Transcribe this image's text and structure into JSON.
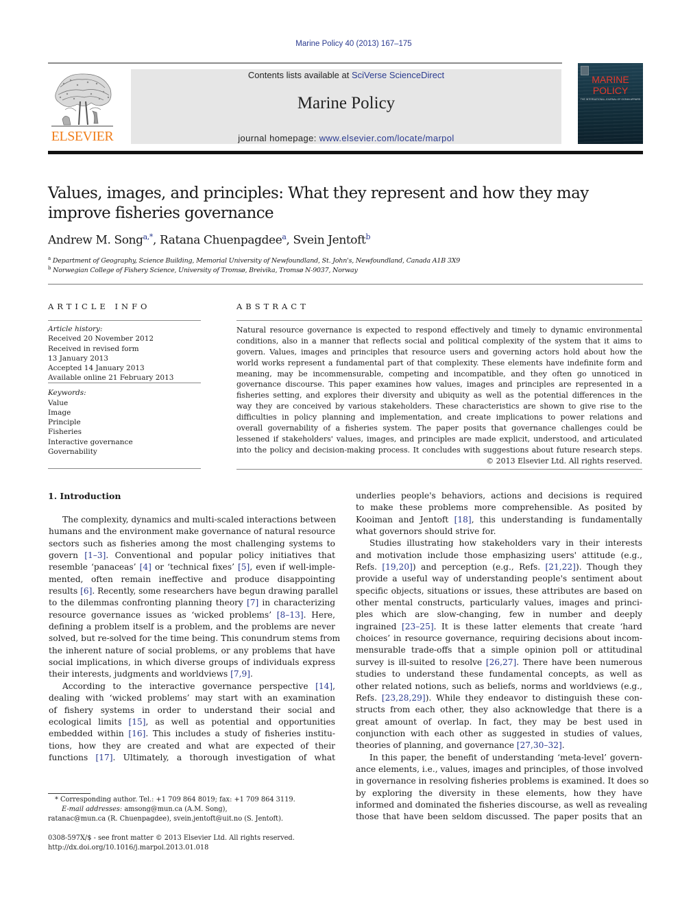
{
  "header": {
    "citation": "Marine Policy 40 (2013) 167–175",
    "contents_prefix": "Contents lists available at ",
    "contents_link": "SciVerse ScienceDirect",
    "journal_title": "Marine Policy",
    "homepage_prefix": "journal homepage: ",
    "homepage_link": "www.elsevier.com/locate/marpol",
    "publisher_logo_text": "ELSEVIER",
    "publisher_logo_icon": "elsevier-tree-icon",
    "cover": {
      "title_line1": "MARINE",
      "title_line2": "POLICY",
      "subtitle": "THE INTERNATIONAL JOURNAL OF OCEAN AFFAIRS"
    }
  },
  "article": {
    "title_line1": "Values, images, and principles: What they represent and how they may",
    "title_line2": "improve fisheries governance",
    "authors": [
      {
        "name": "Andrew M. Song",
        "sup": "a,*",
        "sep": ", "
      },
      {
        "name": "Ratana Chuenpagdee",
        "sup": "a",
        "sep": ", "
      },
      {
        "name": "Svein Jentoft",
        "sup": "b",
        "sep": ""
      }
    ],
    "affiliations": [
      {
        "sup": "a",
        "text": "Department of Geography, Science Building, Memorial University of Newfoundland, St. John's, Newfoundland, Canada A1B 3X9"
      },
      {
        "sup": "b",
        "text": "Norwegian College of Fishery Science, University of Tromsø, Breivika, Tromsø N-9037, Norway"
      }
    ]
  },
  "article_info": {
    "heading": "ARTICLE INFO",
    "history_label": "Article history:",
    "history": [
      "Received 20 November 2012",
      "Received in revised form",
      "13 January 2013",
      "Accepted 14 January 2013",
      "Available online 21 February 2013"
    ],
    "keywords_label": "Keywords:",
    "keywords": [
      "Value",
      "Image",
      "Principle",
      "Fisheries",
      "Interactive governance",
      "Governability"
    ]
  },
  "abstract": {
    "heading": "ABSTRACT",
    "lines": [
      "Natural resource governance is expected to respond effectively and timely to dynamic environmental",
      "conditions, also in a manner that reflects social and political complexity of the system that it aims to",
      "govern. Values, images and principles that resource users and governing actors hold about how the",
      "world works represent a fundamental part of that complexity. These elements have indefinite form and",
      "meaning, may be incommensurable, competing and incompatible, and they often go unnoticed in",
      "governance discourse. This paper examines how values, images and principles are represented in a",
      "fisheries setting, and explores their diversity and ubiquity as well as the potential differences in the",
      "way they are conceived by various stakeholders. These characteristics are shown to give rise to the",
      "difficulties in policy planning and implementation, and create implications to power relations and",
      "overall governability of a fisheries system. The paper posits that governance challenges could be",
      "lessened if stakeholders' values, images, and principles are made explicit, understood, and articulated",
      "into the policy and decision-making process. It concludes with suggestions about future research steps."
    ],
    "copyright": "© 2013 Elsevier Ltd. All rights reserved."
  },
  "body": {
    "section_heading": "1.  Introduction",
    "left_column": [
      {
        "t": "The complexity, dynamics and multi-scaled interactions between",
        "indent": true
      },
      {
        "t": "humans and the environment make governance of natural resource"
      },
      {
        "t": "sectors such as fisheries among the most challenging systems to"
      },
      {
        "t": "govern [1–3]. Conventional and popular policy initiatives that"
      },
      {
        "t": "resemble ‘panaceas’ [4] or ‘technical fixes’ [5], even if well-imple-"
      },
      {
        "t": "mented, often remain ineffective and produce disappointing"
      },
      {
        "t": "results [6]. Recently, some researchers have begun drawing parallel"
      },
      {
        "t": "to the dilemmas confronting planning theory [7] in characterizing"
      },
      {
        "t": "resource governance issues as ‘wicked problems’ [8–13]. Here,"
      },
      {
        "t": "defining a problem itself is a problem, and the problems are never"
      },
      {
        "t": "solved, but re-solved for the time being. This conundrum stems from"
      },
      {
        "t": "the inherent nature of social problems, or any problems that have"
      },
      {
        "t": "social implications, in which diverse groups of individuals express"
      },
      {
        "t": "their interests, judgments and worldviews [7,9].",
        "last": true
      },
      {
        "t": "According to the interactive governance perspective [14],",
        "indent": true
      },
      {
        "t": "dealing with ‘wicked problems’ may start with an examination"
      },
      {
        "t": "of fishery systems in order to understand their social and"
      },
      {
        "t": "ecological limits [15], as well as potential and opportunities"
      },
      {
        "t": "embedded within [16]. This includes a study of fisheries institu-"
      },
      {
        "t": "tions, how they are created and what are expected of their"
      },
      {
        "t": "functions [17]. Ultimately, a thorough investigation of what"
      }
    ],
    "right_column": [
      {
        "t": "underlies people's behaviors, actions and decisions is required"
      },
      {
        "t": "to make these problems more comprehensible. As posited by"
      },
      {
        "t": "Kooiman and Jentoft [18], this understanding is fundamentally"
      },
      {
        "t": "what governors should strive for.",
        "last": true
      },
      {
        "t": "Studies illustrating how stakeholders vary in their interests",
        "indent": true
      },
      {
        "t": "and motivation include those emphasizing users' attitude (e.g.,"
      },
      {
        "t": "Refs. [19,20]) and perception (e.g., Refs. [21,22]). Though they"
      },
      {
        "t": "provide a useful way of understanding people's sentiment about"
      },
      {
        "t": "specific objects, situations or issues, these attributes are based on"
      },
      {
        "t": "other mental constructs, particularly values, images and princi-"
      },
      {
        "t": "ples which are slow-changing, few in number and deeply"
      },
      {
        "t": "ingrained [23–25]. It is these latter elements that create ‘hard"
      },
      {
        "t": "choices’ in resource governance, requiring decisions about incom-"
      },
      {
        "t": "mensurable trade-offs that a simple opinion poll or attitudinal"
      },
      {
        "t": "survey is ill-suited to resolve [26,27]. There have been numerous"
      },
      {
        "t": "studies to understand these fundamental concepts, as well as"
      },
      {
        "t": "other related notions, such as beliefs, norms and worldviews (e.g.,"
      },
      {
        "t": "Refs. [23,28,29]). While they endeavor to distinguish these con-"
      },
      {
        "t": "structs from each other, they also acknowledge that there is a"
      },
      {
        "t": "great amount of overlap. In fact, they may be best used in"
      },
      {
        "t": "conjunction with each other as suggested in studies of values,"
      },
      {
        "t": "theories of planning, and governance [27,30–32].",
        "last": true
      },
      {
        "t": "In this paper, the benefit of understanding ‘meta-level’ govern-",
        "indent": true
      },
      {
        "t": "ance elements, i.e., values, images and principles, of those involved"
      },
      {
        "t": "in governance in resolving fisheries problems is examined. It does so"
      },
      {
        "t": "by exploring the diversity in these elements, how they have"
      },
      {
        "t": "informed and dominated the fisheries discourse, as well as revealing"
      },
      {
        "t": "those that have been seldom discussed. The paper posits that an"
      }
    ]
  },
  "footnotes": {
    "corresponding": "* Corresponding author. Tel.: +1 709 864 8019; fax: +1 709 864 3119.",
    "email_label": "E-mail addresses:",
    "email_line1": " amsong@mun.ca (A.M. Song),",
    "email_line2": "ratanac@mun.ca (R. Chuenpagdee), svein.jentoft@uit.no (S. Jentoft).",
    "front_matter": "0308-597X/$ - see front matter © 2013 Elsevier Ltd. All rights reserved.",
    "doi": "http://dx.doi.org/10.1016/j.marpol.2013.01.018"
  },
  "colors": {
    "link": "#2a3a8f",
    "elsevier_orange": "#f07d1a",
    "banner_gray": "#e6e6e6",
    "cover_title_red": "#e8392b"
  }
}
